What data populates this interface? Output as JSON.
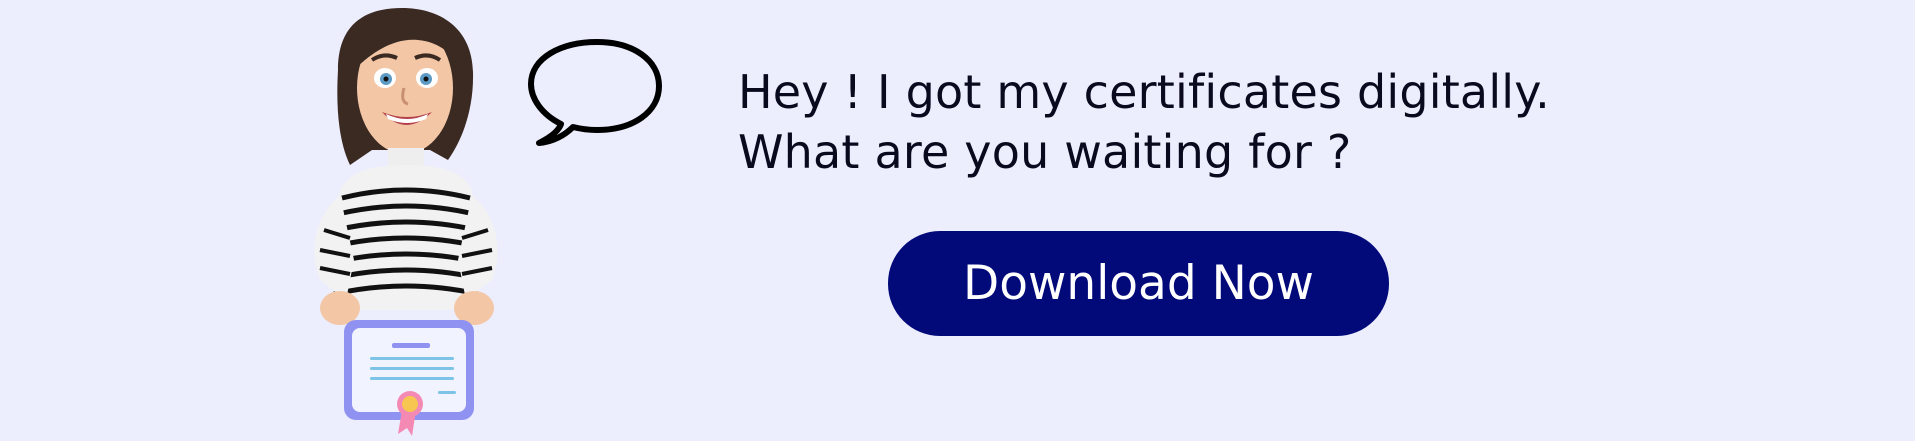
{
  "banner": {
    "headline_line1": "Hey ! I got my certificates digitally.",
    "headline_line2": "What are you waiting for ?",
    "cta_label": "Download Now"
  },
  "colors": {
    "background": "#ecedfd",
    "button": "#020a7a",
    "button_text": "#ffffff",
    "text": "#0a0a1e",
    "certificate": "#8f92f0",
    "ribbon": "#f48ab4",
    "seal": "#f6c650"
  },
  "icons": {
    "speech_bubble": "speech-bubble-icon",
    "certificate": "certificate-icon"
  }
}
